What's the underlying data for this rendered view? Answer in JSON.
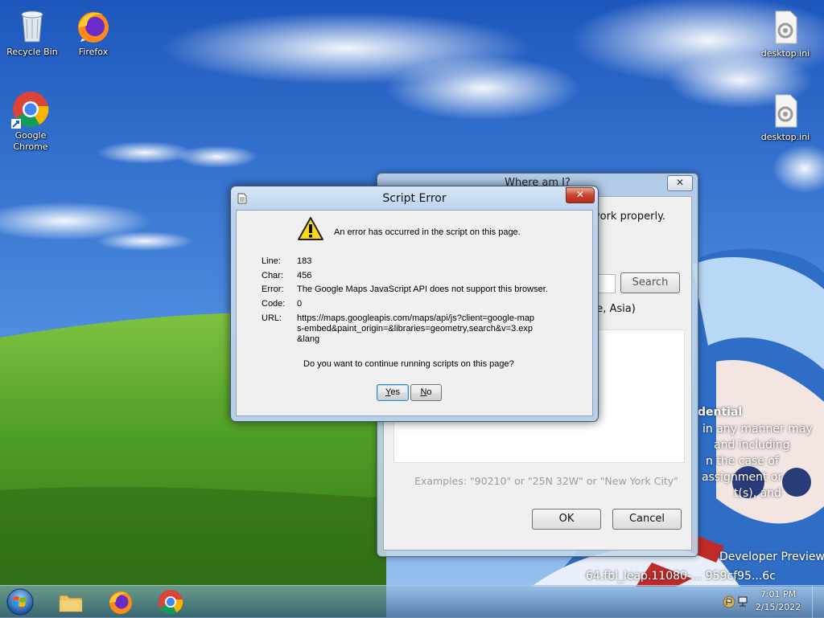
{
  "desktop": {
    "icons": [
      {
        "label": "Recycle Bin",
        "icon": "recycle-bin-icon"
      },
      {
        "label": "Firefox",
        "icon": "firefox-icon"
      },
      {
        "label": "Google Chrome",
        "icon": "chrome-icon"
      },
      {
        "label": "desktop.ini",
        "icon": "settings-file-icon"
      },
      {
        "label": "desktop.ini",
        "icon": "settings-file-icon"
      }
    ],
    "overlay_text": {
      "line1": "dential",
      "line2": "in any manner may",
      "line3": "and including",
      "line4": "n the case of",
      "line5": "assignment or",
      "line6": "t(s), and",
      "build_line1": "Developer Preview",
      "build_line2": "64.fbl_leap.11080-... 959cf95...6c"
    }
  },
  "where_window": {
    "title": "Where am I?",
    "close_glyph": "✕",
    "partial_text": "work properly.",
    "search_label": "Search",
    "region_text": "be, Asia)",
    "examples": "Examples: \"90210\" or \"25N 32W\" or \"New York City\"",
    "ok_label": "OK",
    "cancel_label": "Cancel"
  },
  "script_error": {
    "title": "Script Error",
    "close_glyph": "✕",
    "message": "An error has occurred in the script on this page.",
    "labels": {
      "line": "Line:",
      "char": "Char:",
      "error": "Error:",
      "code": "Code:",
      "url": "URL:"
    },
    "values": {
      "line": "183",
      "char": "456",
      "error": "The Google Maps JavaScript API does not support this browser.",
      "code": "0",
      "url": "https://maps.googleapis.com/maps/api/js?client=google-maps-embed&paint_origin=&libraries=geometry,search&v=3.exp&lang"
    },
    "question": "Do you want to continue running scripts on this page?",
    "yes_first": "Y",
    "yes_rest": "es",
    "no_first": "N",
    "no_rest": "o"
  },
  "taskbar": {
    "pinned": [
      "explorer-folder-icon",
      "firefox-icon",
      "chrome-icon"
    ],
    "time": "7:01 PM",
    "date": "2/15/2022"
  },
  "colors": {
    "sky_top": "#1f5fc2",
    "grass": "#4fa12a",
    "dialog_frame": "#bcd3ec",
    "close_red": "#c7442d"
  }
}
